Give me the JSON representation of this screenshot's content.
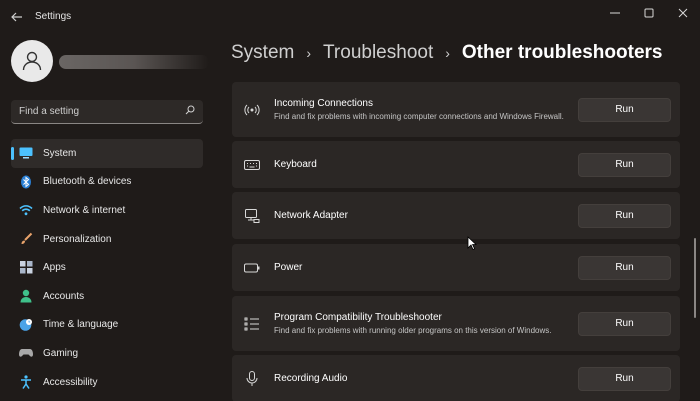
{
  "window": {
    "title": "Settings",
    "controls": [
      "minimize",
      "maximize",
      "close"
    ]
  },
  "search": {
    "placeholder": "Find a setting"
  },
  "sidebar": {
    "items": [
      {
        "label": "System",
        "icon": "monitor-icon",
        "active": true
      },
      {
        "label": "Bluetooth & devices",
        "icon": "bluetooth-icon"
      },
      {
        "label": "Network & internet",
        "icon": "wifi-icon"
      },
      {
        "label": "Personalization",
        "icon": "brush-icon"
      },
      {
        "label": "Apps",
        "icon": "apps-icon"
      },
      {
        "label": "Accounts",
        "icon": "person-icon"
      },
      {
        "label": "Time & language",
        "icon": "globe-clock-icon"
      },
      {
        "label": "Gaming",
        "icon": "gamepad-icon"
      },
      {
        "label": "Accessibility",
        "icon": "accessibility-icon"
      }
    ]
  },
  "breadcrumb": {
    "items": [
      "System",
      "Troubleshoot",
      "Other troubleshooters"
    ],
    "separator": "›"
  },
  "troubleshooters": [
    {
      "title": "Incoming Connections",
      "desc": "Find and fix problems with incoming computer connections and Windows Firewall.",
      "icon": "antenna-icon",
      "button": "Run"
    },
    {
      "title": "Keyboard",
      "desc": "",
      "icon": "keyboard-icon",
      "button": "Run"
    },
    {
      "title": "Network Adapter",
      "desc": "",
      "icon": "network-adapter-icon",
      "button": "Run"
    },
    {
      "title": "Power",
      "desc": "",
      "icon": "battery-icon",
      "button": "Run"
    },
    {
      "title": "Program Compatibility Troubleshooter",
      "desc": "Find and fix problems with running older programs on this version of Windows.",
      "icon": "list-icon",
      "button": "Run"
    },
    {
      "title": "Recording Audio",
      "desc": "",
      "icon": "microphone-icon",
      "button": "Run"
    }
  ],
  "colors": {
    "background": "#1f1b19",
    "card": "#2b2725",
    "accent": "#4cc2ff"
  }
}
